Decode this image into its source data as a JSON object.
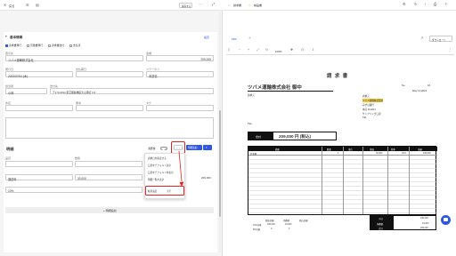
{
  "left_header": {
    "back_label": "戻る",
    "save_label": "保存する"
  },
  "section_title": "基本情報",
  "settings_link": "設定",
  "checkboxes": [
    "請求書発行",
    "見積書発行",
    "請求書送付",
    "支払済"
  ],
  "fields": {
    "customer_label": "取引先",
    "customer_value": "ツバメ運輸株式会社",
    "amount_label": "金額",
    "amount_value": "209,000",
    "issue_date_label": "発行日",
    "issue_date_value": "2024/07/04 (木)",
    "due_date_label": "支払期日",
    "due_date_value": "",
    "status_label": "ステータス",
    "status_value": "未送信",
    "staff_label": "担当者",
    "staff_value": "小林",
    "address_label": "送付先",
    "address_value": "〒173-0014 東京都板橋区大山東町 3-2",
    "subject_label": "件名",
    "memo_label": "備考",
    "tag_label": "タグ"
  },
  "detail": {
    "title": "明細",
    "tax_toggle_label": "消費税",
    "more_label": "・・・",
    "add_button": "明細追加",
    "item_label": "品目",
    "qty_label": "数量",
    "unit_price_label": "単価",
    "tax_label": "税率",
    "item_value": "運送料",
    "unit_price_value": "30,000",
    "tax_value": "10%",
    "total_value": "209,000",
    "add_row_label": "+ 明細追加"
  },
  "dropdown": {
    "items": [
      "請求日を指定する",
      "口座をデフォルト表示",
      "口座をデフォルト非表示",
      "明細一覧を表示",
      "帳票設定"
    ],
    "highlight_index": 4,
    "highlight_suffix": "選択"
  },
  "right_header": {
    "tab1": "請求書",
    "tab2": "納品書",
    "download_label": "ダウンロード"
  },
  "preview_tab": "PDF",
  "zoom": "100%",
  "doc": {
    "title": "請 求 書",
    "recipient": "ツバメ運輸株式会社 御中",
    "recipient_sub": "請求元",
    "no_label": "No.",
    "no_value": "10",
    "date_value": "May 13 2024",
    "issuer_lines": [
      "請求元",
      "ツバメ運輸株式会社",
      "みずほ銀行",
      "本店 1111111",
      "サンプリング口座",
      "TEL"
    ],
    "tel_label": "TEL:",
    "total_label": "合計",
    "total_value": "209,000 円 (税込)",
    "table_headers": [
      "摘要",
      "数量",
      "単位",
      "単価",
      "税率",
      "金額"
    ],
    "table_row": [
      "作業費",
      "1",
      "",
      "30,000",
      "10%",
      "190,000"
    ],
    "summary_labels": [
      "小計",
      "消費税",
      "合計"
    ],
    "summary_values": [
      "190,000",
      "19,000",
      "209,000"
    ],
    "tax_table_headers": [
      "",
      "税抜金額",
      "消費税",
      "税込金額"
    ],
    "tax_rows": [
      [
        "10%対象",
        "190,000",
        "19,000"
      ],
      [
        "8%対象",
        "0",
        "0"
      ]
    ]
  },
  "colors": {
    "accent": "#2f57e6",
    "highlight": "#e0261f",
    "doc_black": "#111",
    "yellow": "#f7c93b"
  }
}
